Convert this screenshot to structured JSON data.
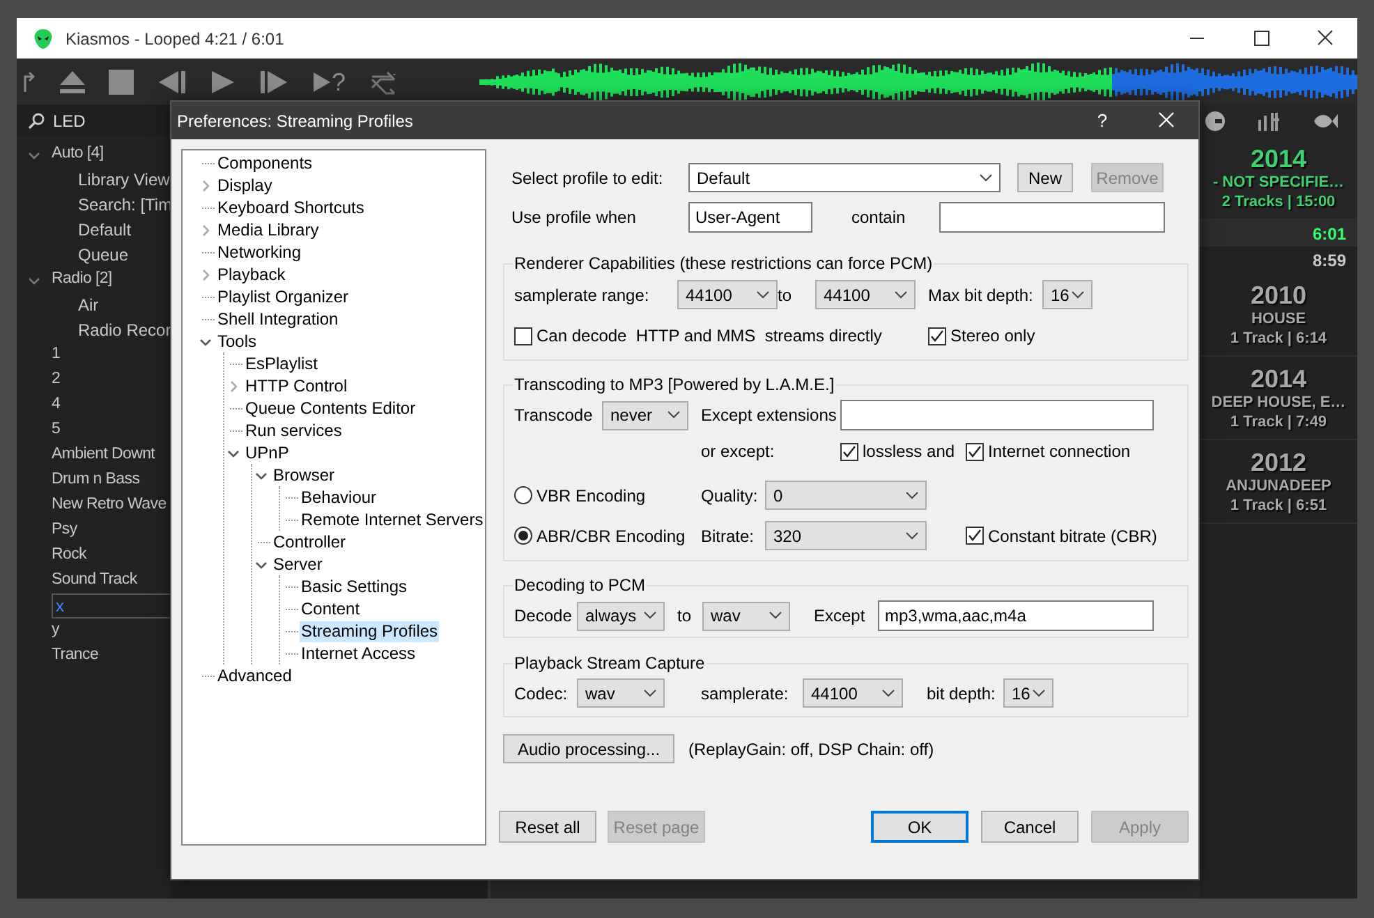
{
  "app_window": {
    "title": "Kiasmos - Looped 4:21 / 6:01"
  },
  "toolbar": {
    "random_glyph": "?"
  },
  "playback": {
    "level": 0.72
  },
  "search": {
    "value": "LED"
  },
  "playlists": [
    {
      "label": "Auto [4]",
      "expanded": true,
      "editing": false,
      "children": [
        {
          "label": "Library View"
        },
        {
          "label": "Search: [Tim"
        },
        {
          "label": "Default"
        },
        {
          "label": "Queue"
        }
      ]
    },
    {
      "label": "Radio [2]",
      "expanded": true,
      "editing": false,
      "children": [
        {
          "label": "Air"
        },
        {
          "label": "Radio Recor"
        }
      ]
    },
    {
      "label": "1",
      "editing": false
    },
    {
      "label": "2",
      "editing": false
    },
    {
      "label": "4",
      "editing": false
    },
    {
      "label": "5",
      "editing": false
    },
    {
      "label": "Ambient Downt",
      "editing": false
    },
    {
      "label": "Drum n Bass",
      "editing": false
    },
    {
      "label": "New Retro Wave",
      "editing": false
    },
    {
      "label": "Psy",
      "editing": false
    },
    {
      "label": "Rock",
      "editing": false
    },
    {
      "label": "Sound Track",
      "editing": false
    },
    {
      "label": "x",
      "editing": true
    },
    {
      "label": "y",
      "editing": false
    },
    {
      "label": "Trance",
      "editing": false
    }
  ],
  "now_playing": [
    {
      "kind": "album",
      "year": "2014",
      "genre": "- NOT SPECIFIE…",
      "tracks": "2 Tracks | 15:00",
      "playing": true
    },
    {
      "kind": "track",
      "time": "6:01",
      "playing": true
    },
    {
      "kind": "track",
      "time": "8:59",
      "playing": false
    },
    {
      "kind": "album",
      "year": "2010",
      "genre": "HOUSE",
      "tracks": "1 Track | 6:14",
      "playing": false
    },
    {
      "kind": "album",
      "year": "2014",
      "genre": "DEEP HOUSE, E…",
      "tracks": "1 Track | 7:49",
      "playing": false
    },
    {
      "kind": "album",
      "year": "2012",
      "genre": "ANJUNADEEP",
      "tracks": "1 Track | 6:51",
      "playing": false
    }
  ],
  "dialog": {
    "title": "Preferences: Streaming Profiles",
    "help": "?",
    "tree": [
      {
        "label": "Components",
        "selected": false
      },
      {
        "label": "Display",
        "expanded": false,
        "selected": false
      },
      {
        "label": "Keyboard Shortcuts",
        "selected": false
      },
      {
        "label": "Media Library",
        "expanded": false,
        "selected": false
      },
      {
        "label": "Networking",
        "selected": false
      },
      {
        "label": "Playback",
        "expanded": false,
        "selected": false
      },
      {
        "label": "Playlist Organizer",
        "selected": false
      },
      {
        "label": "Shell Integration",
        "selected": false
      },
      {
        "label": "Tools",
        "expanded": true,
        "selected": false,
        "children": [
          {
            "label": "EsPlaylist",
            "selected": false
          },
          {
            "label": "HTTP Control",
            "expanded": false,
            "selected": false
          },
          {
            "label": "Queue Contents Editor",
            "selected": false
          },
          {
            "label": "Run services",
            "selected": false
          },
          {
            "label": "UPnP",
            "expanded": true,
            "selected": false,
            "children": [
              {
                "label": "Browser",
                "expanded": true,
                "selected": false,
                "children": [
                  {
                    "label": "Behaviour",
                    "selected": false
                  },
                  {
                    "label": "Remote Internet Servers",
                    "selected": false
                  }
                ]
              },
              {
                "label": "Controller",
                "selected": false
              },
              {
                "label": "Server",
                "expanded": true,
                "selected": false,
                "children": [
                  {
                    "label": "Basic Settings",
                    "selected": false
                  },
                  {
                    "label": "Content",
                    "selected": false
                  },
                  {
                    "label": "Streaming Profiles",
                    "selected": true
                  },
                  {
                    "label": "Internet Access",
                    "selected": false
                  }
                ]
              }
            ]
          }
        ]
      },
      {
        "label": "Advanced",
        "selected": false
      }
    ],
    "profile": {
      "label": "Select profile to edit:",
      "value": "Default"
    },
    "profile_buttons": [
      {
        "label": "New",
        "disabled": false
      },
      {
        "label": "Remove",
        "disabled": true
      }
    ],
    "use_when": {
      "label": "Use profile when",
      "value": "User-Agent",
      "contain_label": "contain"
    },
    "renderer": {
      "title": "Renderer Capabilities (these restrictions can force PCM)",
      "range_label": "samplerate range:",
      "range_from": "44100",
      "to_label": "to",
      "range_to": "44100",
      "depth_label": "Max bit depth:",
      "depth": "16",
      "direct": {
        "label": "Can decode  HTTP and MMS  streams directly",
        "checked": false
      },
      "stereo": {
        "label": "Stereo only",
        "checked": true
      }
    },
    "transcoding": {
      "title": "Transcoding to MP3 [Powered by L.A.M.E.]",
      "transcode_label": "Transcode",
      "transcode": "never",
      "ext_label": "Except extensions",
      "or_label": "or except:",
      "lossless": {
        "label": "lossless and",
        "checked": true
      },
      "internet": {
        "label": "Internet connection",
        "checked": true
      },
      "modes": [
        {
          "label": "VBR Encoding",
          "selected": false,
          "field_label": "Quality:",
          "value": "0"
        },
        {
          "label": "ABR/CBR Encoding",
          "selected": true,
          "field_label": "Bitrate:",
          "value": "320"
        }
      ],
      "cbr": {
        "label": "Constant bitrate (CBR)",
        "checked": true
      }
    },
    "decoding": {
      "title": "Decoding to PCM",
      "decode_label": "Decode",
      "decode": "always",
      "to_label": "to",
      "format": "wav",
      "except_label": "Except",
      "except": "mp3,wma,aac,m4a"
    },
    "capture": {
      "title": "Playback Stream Capture",
      "codec_label": "Codec:",
      "codec": "wav",
      "rate_label": "samplerate:",
      "rate": "44100",
      "depth_label": "bit depth:",
      "depth": "16"
    },
    "audio": {
      "button": "Audio processing...",
      "status": "(ReplayGain: off, DSP Chain: off)"
    },
    "page_buttons": [
      {
        "label": "Reset all",
        "disabled": false,
        "default": false
      },
      {
        "label": "Reset page",
        "disabled": true,
        "default": false
      }
    ],
    "dialog_buttons": [
      {
        "label": "OK",
        "disabled": false,
        "default": true
      },
      {
        "label": "Cancel",
        "disabled": false,
        "default": false
      },
      {
        "label": "Apply",
        "disabled": true,
        "default": false
      }
    ]
  }
}
